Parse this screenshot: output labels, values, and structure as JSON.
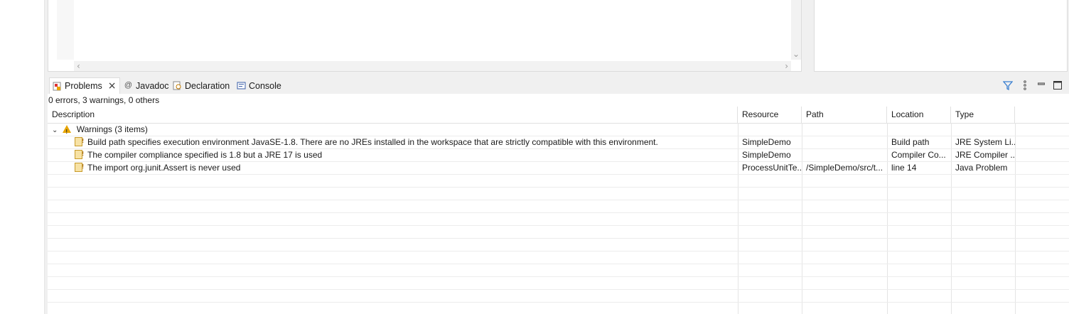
{
  "tabs": [
    {
      "label": "Problems",
      "icon": "problems-icon",
      "active": true,
      "close": "×"
    },
    {
      "label": "Javadoc",
      "icon": "javadoc-icon",
      "glyph": "@"
    },
    {
      "label": "Declaration",
      "icon": "declaration-icon"
    },
    {
      "label": "Console",
      "icon": "console-icon"
    }
  ],
  "summary": "0 errors, 3 warnings, 0 others",
  "columns": [
    "Description",
    "Resource",
    "Path",
    "Location",
    "Type"
  ],
  "group": {
    "label": "Warnings (3 items)",
    "icon": "warning-icon",
    "expanded": true
  },
  "rows": [
    {
      "description": "Build path specifies execution environment JavaSE-1.8. There are no JREs installed in the workspace that are strictly compatible with this environment.",
      "resource": "SimpleDemo",
      "path": "",
      "location": "Build path",
      "type": "JRE System Li..."
    },
    {
      "description": "The compiler compliance specified is 1.8 but a JRE 17 is used",
      "resource": "SimpleDemo",
      "path": "",
      "location": "Compiler Co...",
      "type": "JRE Compiler ..."
    },
    {
      "description": "The import org.junit.Assert is never used",
      "resource": "ProcessUnitTe...",
      "path": "/SimpleDemo/src/t...",
      "location": "line 14",
      "type": "Java Problem"
    }
  ],
  "colors": {
    "warning": "#e8a500",
    "accent": "#1e6fc8"
  }
}
